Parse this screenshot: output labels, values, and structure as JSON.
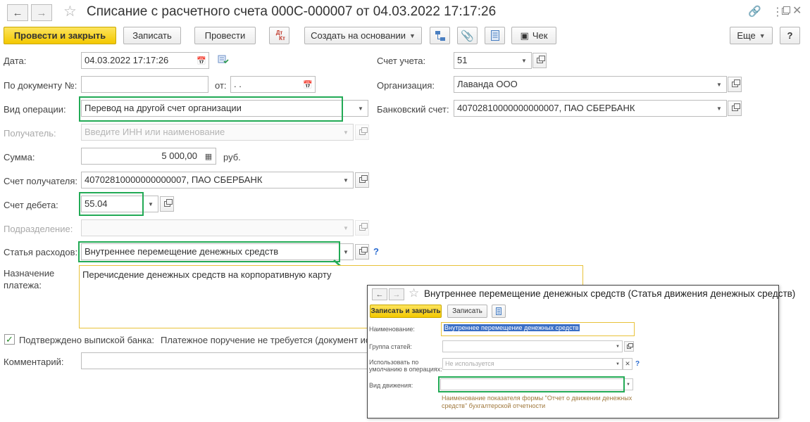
{
  "window": {
    "title": "Списание с расчетного счета 000С-000007 от 04.03.2022 17:17:26"
  },
  "toolbar": {
    "post_close": "Провести и закрыть",
    "save": "Записать",
    "post": "Провести",
    "dtkt_top": "Дт",
    "dtkt_bottom": "Кт",
    "create_based": "Создать на основании",
    "check": "Чек",
    "more": "Еще",
    "help": "?"
  },
  "form": {
    "date": {
      "label": "Дата:",
      "value": "04.03.2022 17:17:26"
    },
    "doc_number": {
      "label": "По документу №:",
      "value": "",
      "from_label": "от:",
      "from_value": " .  ."
    },
    "operation": {
      "label": "Вид операции:",
      "value": "Перевод на другой счет организации"
    },
    "recipient": {
      "label": "Получатель:",
      "placeholder": "Введите ИНН или наименование"
    },
    "amount": {
      "label": "Сумма:",
      "value": "5 000,00",
      "currency": "руб."
    },
    "recipient_account": {
      "label": "Счет получателя:",
      "value": "40702810000000000007, ПАО СБЕРБАНК"
    },
    "debit_account": {
      "label": "Счет дебета:",
      "value": "55.04"
    },
    "department": {
      "label": "Подразделение:",
      "value": ""
    },
    "expense_item": {
      "label": "Статья расходов:",
      "value": "Внутреннее перемещение денежных средств",
      "help": "?"
    },
    "purpose": {
      "label_line1": "Назначение",
      "label_line2": "платежа:",
      "value": "Перечисдение денежных средств на корпоративную карту"
    },
    "confirmed": {
      "label": "Подтверждено выпиской банка:",
      "checked": true,
      "note": "Платежное поручение не требуется (документ ис"
    },
    "comment": {
      "label": "Комментарий:",
      "value": ""
    },
    "account": {
      "label": "Счет учета:",
      "value": "51"
    },
    "organization": {
      "label": "Организация:",
      "value": "Лаванда ООО"
    },
    "bank_account": {
      "label": "Банковский счет:",
      "value": "40702810000000000007, ПАО СБЕРБАНК"
    }
  },
  "popup": {
    "title": "Внутреннее перемещение денежных средств (Статья движения денежных средств)",
    "save_close": "Записать и закрыть",
    "save": "Записать",
    "name": {
      "label": "Наименование:",
      "value": "Внутреннее перемещение денежных средств"
    },
    "group": {
      "label": "Группа статей:",
      "value": ""
    },
    "default_use": {
      "label_line1": "Использовать по",
      "label_line2": "умолчанию в операциях:",
      "value": "Не используется",
      "help": "?"
    },
    "movement_type": {
      "label": "Вид движения:",
      "value": ""
    },
    "hint_line1": "Наименование показателя формы \"Отчет о движении денежных",
    "hint_line2": "средств\" бухгалтерской отчетности"
  },
  "colors": {
    "primary_button": "#f3c800",
    "highlight_frame": "#22aa55",
    "selection": "#3a6fc6"
  }
}
